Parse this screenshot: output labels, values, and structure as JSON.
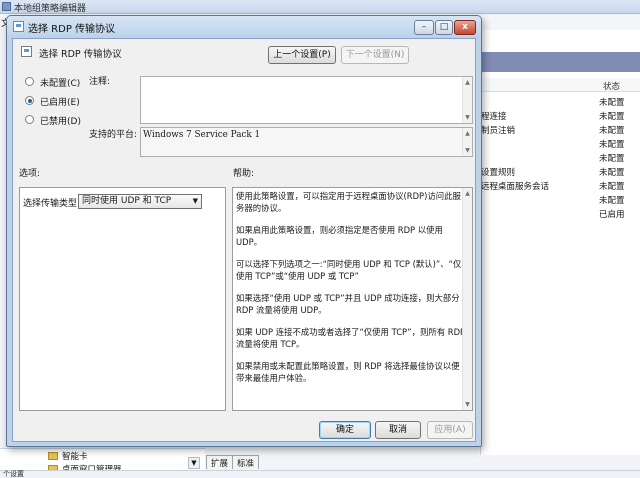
{
  "background": {
    "window_title": "本地组策略编辑器",
    "menu_file": "文",
    "table_header_state": "状态",
    "rows": [
      {
        "name": "",
        "state": "未配置"
      },
      {
        "name": "程连接",
        "state": "未配置"
      },
      {
        "name": "制员注销",
        "state": "未配置"
      },
      {
        "name": "",
        "state": "未配置"
      },
      {
        "name": "",
        "state": "未配置"
      },
      {
        "name": "设置规则",
        "state": "未配置"
      },
      {
        "name": "远程桌面服务会话",
        "state": "未配置"
      },
      {
        "name": "",
        "state": "未配置"
      },
      {
        "name": "",
        "state": "已启用"
      }
    ],
    "tree_items": [
      "智能卡",
      "桌面窗口管理器"
    ],
    "tabs": [
      "扩展",
      "标准"
    ],
    "status_text": "个设置"
  },
  "dialog": {
    "title": "选择 RDP 传输协议",
    "controls": {
      "minimize": "–",
      "maximize": "□",
      "close": "x"
    },
    "header_title": "选择 RDP 传输协议",
    "prev_button": "上一个设置(P)",
    "next_button": "下一个设置(N)",
    "radios": [
      {
        "label": "未配置(C)",
        "checked": false
      },
      {
        "label": "已启用(E)",
        "checked": true
      },
      {
        "label": "已禁用(D)",
        "checked": false
      }
    ],
    "comment_label": "注释:",
    "comment_value": "",
    "platform_label": "支持的平台:",
    "platform_value": "Windows 7 Service Pack 1",
    "options_label": "选项:",
    "help_label": "帮助:",
    "option_field_label": "选择传输类型",
    "option_field_value": "同时使用 UDP 和 TCP",
    "help_paragraphs": [
      "使用此策略设置，可以指定用于远程桌面协议(RDP)访问此服务器的协议。",
      "如果启用此策略设置，则必须指定是否使用 RDP 以使用 UDP。",
      "可以选择下列选项之一:“同时使用 UDP 和 TCP (默认)”、“仅使用 TCP”或“使用 UDP 或 TCP”",
      "如果选择“使用 UDP 或 TCP”并且 UDP 成功连接，则大部分 RDP 流量将使用 UDP。",
      "如果 UDP 连接不成功或者选择了“仅使用 TCP”，则所有 RDP 流量将使用 TCP。",
      "如果禁用或未配置此策略设置，则 RDP 将选择最佳协议以便带来最佳用户体验。"
    ],
    "ok_button": "确定",
    "cancel_button": "取消",
    "apply_button": "应用(A)"
  }
}
